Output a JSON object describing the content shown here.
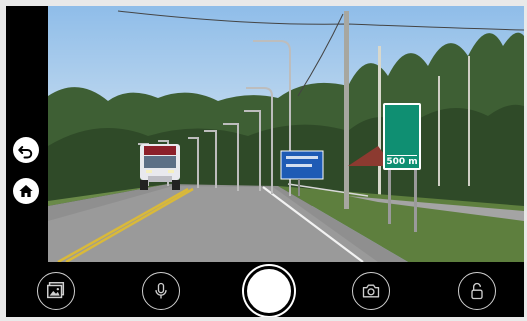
{
  "left_rail": {
    "buttons": [
      {
        "icon": "undo-icon"
      },
      {
        "icon": "home-icon"
      }
    ]
  },
  "viewport": {
    "sign": {
      "symbol": "car-icon",
      "distance_label": "500 m",
      "color": "#0f8f72"
    }
  },
  "toolbar": {
    "buttons": [
      {
        "icon": "gallery-icon"
      },
      {
        "icon": "microphone-icon"
      },
      {
        "icon": "shutter-button"
      },
      {
        "icon": "camera-icon"
      },
      {
        "icon": "unlock-icon"
      }
    ]
  }
}
